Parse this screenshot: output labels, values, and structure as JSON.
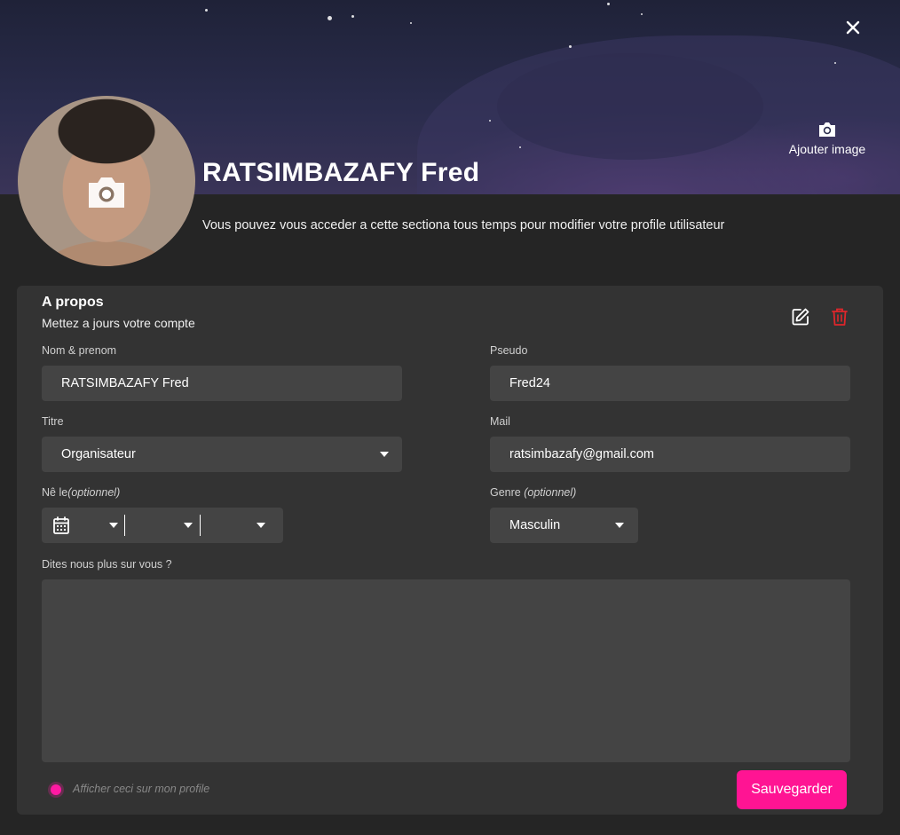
{
  "header": {
    "add_image_label": "Ajouter image",
    "name": "RATSIMBAZAFY Fred",
    "description": "Vous pouvez vous acceder a cette sectiona tous temps pour modifier votre profile utilisateur"
  },
  "about": {
    "title": "A propos",
    "subtitle": "Mettez a jours votre compte",
    "fields": {
      "fullname": {
        "label": "Nom & prenom",
        "value": "RATSIMBAZAFY Fred"
      },
      "pseudo": {
        "label": "Pseudo",
        "value": "Fred24"
      },
      "titre": {
        "label": "Titre",
        "value": "Organisateur"
      },
      "mail": {
        "label": "Mail",
        "value": "ratsimbazafy@gmail.com"
      },
      "birth": {
        "label": "Nê le",
        "optional": "(optionnel)"
      },
      "genre": {
        "label": "Genre ",
        "optional": "(optionnel)",
        "value": "Masculin"
      },
      "bio": {
        "label": "Dites nous plus sur vous ?",
        "value": ""
      }
    },
    "show_on_profile_label": "Afficher ceci sur mon profile",
    "save_label": "Sauvegarder"
  },
  "colors": {
    "accent": "#ff1493",
    "delete": "#e0262b",
    "card_bg": "#333333",
    "field_bg": "#444444",
    "page_bg": "#252525"
  },
  "icons": {
    "close": "close-icon",
    "camera": "camera-icon",
    "edit": "edit-icon",
    "delete": "trash-icon",
    "calendar": "calendar-icon",
    "dropdown": "caret-down-icon"
  }
}
